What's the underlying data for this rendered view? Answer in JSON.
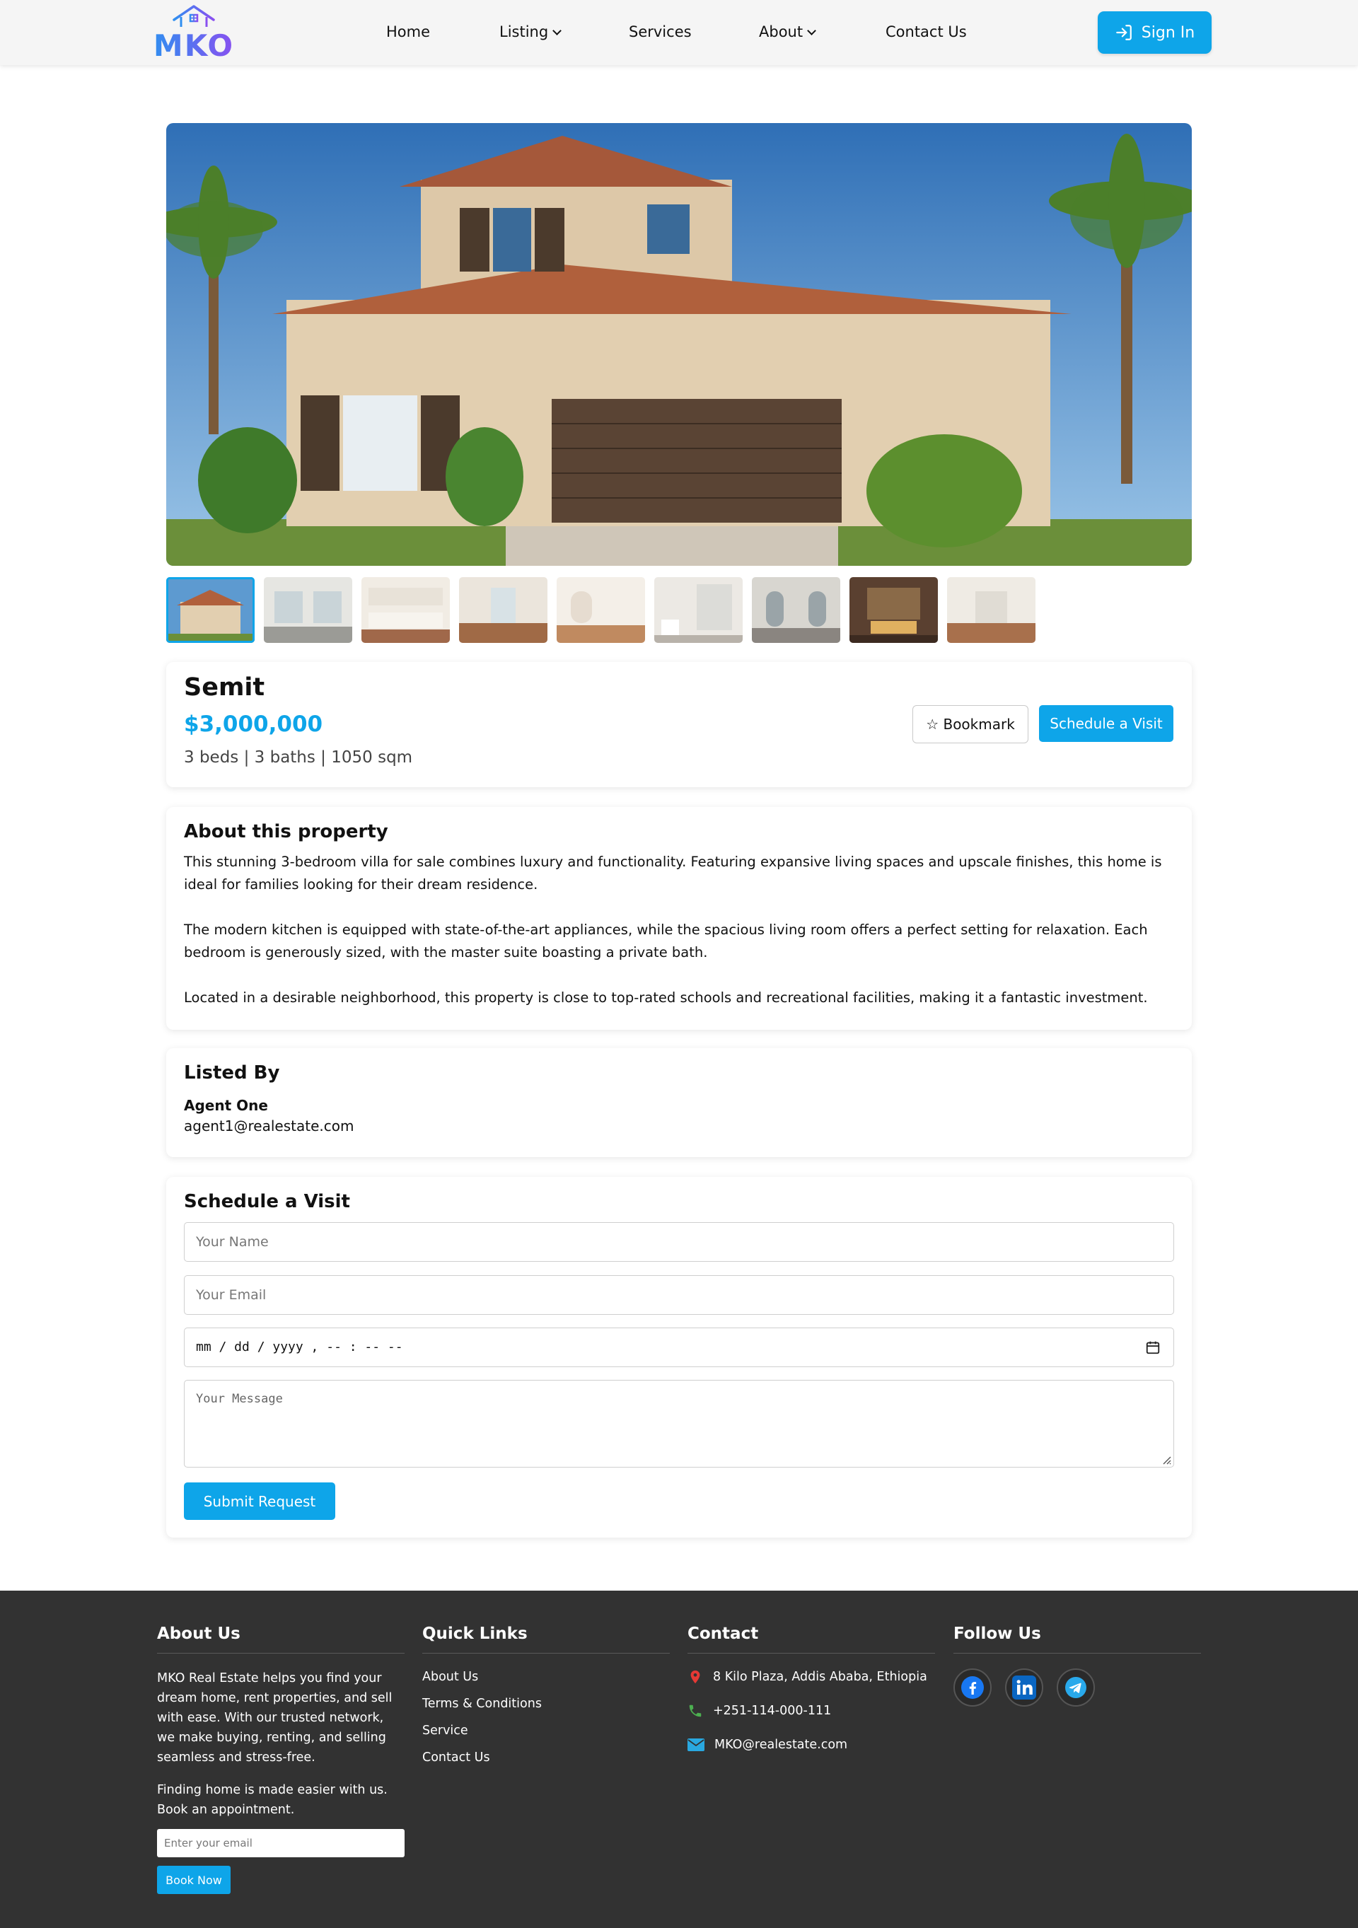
{
  "brand": {
    "logo_text": "MKO"
  },
  "nav": {
    "items": [
      {
        "label": "Home",
        "has_dropdown": false
      },
      {
        "label": "Listing",
        "has_dropdown": true
      },
      {
        "label": "Services",
        "has_dropdown": false
      },
      {
        "label": "About",
        "has_dropdown": true
      },
      {
        "label": "Contact Us",
        "has_dropdown": false
      }
    ],
    "signin_label": "Sign In"
  },
  "gallery": {
    "main_image": "house-exterior",
    "thumbnails": [
      "house-exterior",
      "living-room",
      "kitchen",
      "open-plan-room",
      "empty-room",
      "bathroom",
      "bedroom",
      "master-bath",
      "hallway"
    ],
    "active_index": 0
  },
  "property": {
    "title": "Semit",
    "price": "$3,000,000",
    "specs": "3 beds | 3 baths | 1050 sqm",
    "bookmark_label": "☆ Bookmark",
    "schedule_label": "Schedule a Visit"
  },
  "about": {
    "heading": "About this property",
    "paragraphs": [
      "This stunning 3-bedroom villa for sale combines luxury and functionality. Featuring expansive living spaces and upscale finishes, this home is ideal for families looking for their dream residence.",
      "The modern kitchen is equipped with state-of-the-art appliances, while the spacious living room offers a perfect setting for relaxation. Each bedroom is generously sized, with the master suite boasting a private bath.",
      "Located in a desirable neighborhood, this property is close to top-rated schools and recreational facilities, making it a fantastic investment."
    ]
  },
  "listed_by": {
    "heading": "Listed By",
    "agent_name": "Agent One",
    "agent_email": "agent1@realestate.com"
  },
  "visit_form": {
    "heading": "Schedule a Visit",
    "name_placeholder": "Your Name",
    "email_placeholder": "Your Email",
    "datetime_value": "mm / dd / yyyy ,  -- : --  --",
    "message_placeholder": "Your Message",
    "submit_label": "Submit Request"
  },
  "footer": {
    "about": {
      "heading": "About Us",
      "text": "MKO Real Estate helps you find your dream home, rent properties, and sell with ease. With our trusted network, we make buying, renting, and selling seamless and stress-free.",
      "tagline": "Finding home is made easier with us. Book an appointment.",
      "email_placeholder": "Enter your email",
      "book_label": "Book Now"
    },
    "quick_links": {
      "heading": "Quick Links",
      "links": [
        "About Us",
        "Terms & Conditions",
        "Service",
        "Contact Us"
      ]
    },
    "contact": {
      "heading": "Contact",
      "address": "8 Kilo Plaza, Addis Ababa, Ethiopia",
      "phone": "+251-114-000-111",
      "email": "MKO@realestate.com"
    },
    "follow": {
      "heading": "Follow Us",
      "networks": [
        "facebook",
        "linkedin",
        "telegram"
      ]
    }
  },
  "colors": {
    "accent": "#0ea5e9",
    "footer_bg": "#323232",
    "logo_gradient": [
      "#2f8ff0",
      "#8a4ff0"
    ]
  }
}
